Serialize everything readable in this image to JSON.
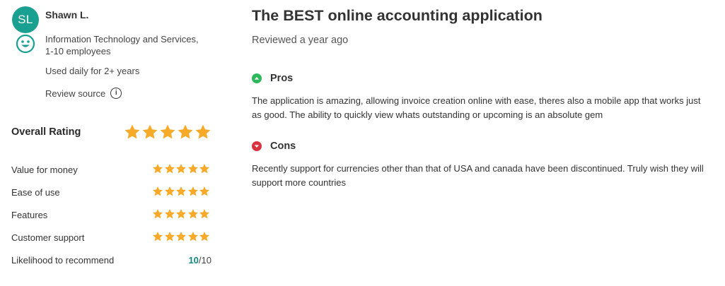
{
  "reviewer": {
    "initials": "SL",
    "name": "Shawn L.",
    "industry": "Information Technology and Services,",
    "company_size": "1-10 employees",
    "usage": "Used daily for 2+ years",
    "source_label": "Review source",
    "avatar_color": "#1aa090"
  },
  "ratings": {
    "overall_label": "Overall Rating",
    "overall_stars": 5,
    "star_color": "#f7a928",
    "rows": [
      {
        "label": "Value for money",
        "stars": 5
      },
      {
        "label": "Ease of use",
        "stars": 5
      },
      {
        "label": "Features",
        "stars": 5
      },
      {
        "label": "Customer support",
        "stars": 5
      }
    ],
    "recommend_label": "Likelihood to recommend",
    "recommend_score": "10",
    "recommend_max": "/10"
  },
  "review": {
    "title": "The BEST online accounting application",
    "reviewed": "Reviewed a year ago",
    "pros_label": "Pros",
    "pros_text": "The application is amazing, allowing invoice creation online with ease, theres also a mobile app that works just as good. The ability to quickly view whats outstanding or upcoming is an absolute gem",
    "cons_label": "Cons",
    "cons_text": "Recently support for currencies other than that of USA and canada have been discontinued. Truly wish they will support more countries",
    "pros_color": "#2eb85c",
    "cons_color": "#d9333f"
  }
}
